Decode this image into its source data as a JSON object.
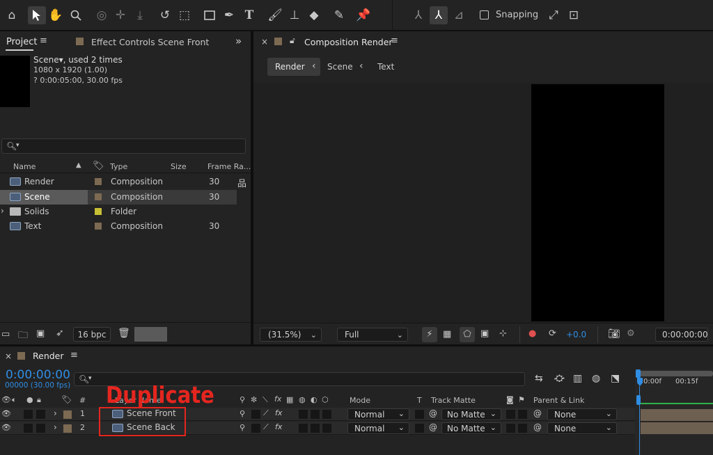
{
  "toolbar": {
    "snapping_label": "Snapping"
  },
  "project_panel": {
    "tab_project": "Project",
    "tab_effect_controls": "Effect Controls Scene Front",
    "preview": {
      "name": "Scene",
      "usage": ", used 2 times",
      "dimensions": "1080 x 1920 (1.00)",
      "duration": "? 0:00:05:00, 30.00 fps"
    },
    "search_placeholder": "",
    "columns": {
      "name": "Name",
      "type": "Type",
      "size": "Size",
      "frame_rate": "Frame Ra..."
    },
    "items": [
      {
        "name": "Render",
        "type": "Composition",
        "frame_rate": "30",
        "kind": "composition",
        "color": "#7d6a52"
      },
      {
        "name": "Scene",
        "type": "Composition",
        "frame_rate": "30",
        "kind": "composition",
        "color": "#7d6a52"
      },
      {
        "name": "Solids",
        "type": "Folder",
        "frame_rate": "",
        "kind": "folder",
        "color": "#c8c034"
      },
      {
        "name": "Text",
        "type": "Composition",
        "frame_rate": "30",
        "kind": "composition",
        "color": "#7d6a52"
      }
    ],
    "bit_depth": "16 bpc"
  },
  "viewer": {
    "title": "Composition Render",
    "breadcrumbs": [
      "Render",
      "Scene",
      "Text"
    ],
    "zoom": "(31.5%)",
    "resolution": "Full",
    "exposure": "+0.0",
    "timecode": "0:00:00:00"
  },
  "timeline": {
    "tab_title": "Render",
    "current_time": "0:00:00:00",
    "frame_info": "00000 (30.00 fps)",
    "search_placeholder": "",
    "columns": {
      "num": "#",
      "layer_name": "Layer Name",
      "mode": "Mode",
      "t": "T",
      "track_matte": "Track Matte",
      "parent_link": "Parent & Link"
    },
    "ruler": {
      "start": "0:00f",
      "mark": "00:15f"
    },
    "layers": [
      {
        "num": "1",
        "name": "Scene Front",
        "mode": "Normal",
        "track_matte": "No Matte",
        "parent": "None"
      },
      {
        "num": "2",
        "name": "Scene Back",
        "mode": "Normal",
        "track_matte": "No Matte",
        "parent": "None"
      }
    ],
    "annotation": "Duplicate"
  },
  "colors": {
    "accent_blue": "#2f8de4",
    "annotation_red": "#e5261f",
    "label_tan": "#7d6a52",
    "folder_yellow": "#c8c034"
  }
}
